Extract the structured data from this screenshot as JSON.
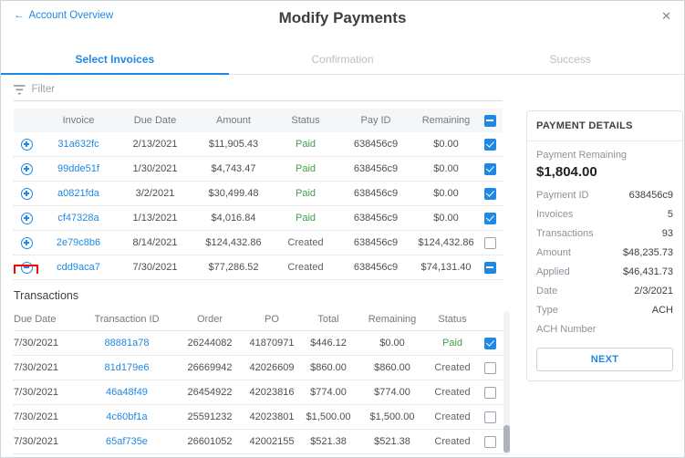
{
  "header": {
    "back_arrow": "←",
    "back_label": "Account Overview",
    "title": "Modify Payments",
    "close_glyph": "✕"
  },
  "tabs": [
    {
      "label": "Select Invoices",
      "active": true
    },
    {
      "label": "Confirmation",
      "active": false
    },
    {
      "label": "Success",
      "active": false
    }
  ],
  "filter": {
    "placeholder": "Filter"
  },
  "invoice_table": {
    "columns": [
      "Invoice",
      "Due Date",
      "Amount",
      "Status",
      "Pay ID",
      "Remaining"
    ],
    "header_checkbox": "indeterminate",
    "rows": [
      {
        "expand": "plus",
        "invoice": "31a632fc",
        "due_date": "2/13/2021",
        "amount": "$11,905.43",
        "status": "Paid",
        "pay_id": "638456c9",
        "remaining": "$0.00",
        "checkbox": "checked"
      },
      {
        "expand": "plus",
        "invoice": "99dde51f",
        "due_date": "1/30/2021",
        "amount": "$4,743.47",
        "status": "Paid",
        "pay_id": "638456c9",
        "remaining": "$0.00",
        "checkbox": "checked"
      },
      {
        "expand": "plus",
        "invoice": "a0821fda",
        "due_date": "3/2/2021",
        "amount": "$30,499.48",
        "status": "Paid",
        "pay_id": "638456c9",
        "remaining": "$0.00",
        "checkbox": "checked"
      },
      {
        "expand": "plus",
        "invoice": "cf47328a",
        "due_date": "1/13/2021",
        "amount": "$4,016.84",
        "status": "Paid",
        "pay_id": "638456c9",
        "remaining": "$0.00",
        "checkbox": "checked"
      },
      {
        "expand": "plus",
        "invoice": "2e79c8b6",
        "due_date": "8/14/2021",
        "amount": "$124,432.86",
        "status": "Created",
        "pay_id": "638456c9",
        "remaining": "$124,432.86",
        "checkbox": "unchecked"
      },
      {
        "expand": "minus",
        "invoice": "cdd9aca7",
        "due_date": "7/30/2021",
        "amount": "$77,286.52",
        "status": "Created",
        "pay_id": "638456c9",
        "remaining": "$74,131.40",
        "checkbox": "indeterminate"
      }
    ]
  },
  "transactions": {
    "title": "Transactions",
    "columns": [
      "Due Date",
      "Transaction ID",
      "Order",
      "PO",
      "Total",
      "Remaining",
      "Status"
    ],
    "rows": [
      {
        "due_date": "7/30/2021",
        "transaction_id": "88881a78",
        "order": "26244082",
        "po": "41870971",
        "total": "$446.12",
        "remaining": "$0.00",
        "status": "Paid",
        "checkbox": "checked"
      },
      {
        "due_date": "7/30/2021",
        "transaction_id": "81d179e6",
        "order": "26669942",
        "po": "42026609",
        "total": "$860.00",
        "remaining": "$860.00",
        "status": "Created",
        "checkbox": "unchecked"
      },
      {
        "due_date": "7/30/2021",
        "transaction_id": "46a48f49",
        "order": "26454922",
        "po": "42023816",
        "total": "$774.00",
        "remaining": "$774.00",
        "status": "Created",
        "checkbox": "unchecked"
      },
      {
        "due_date": "7/30/2021",
        "transaction_id": "4c60bf1a",
        "order": "25591232",
        "po": "42023801",
        "total": "$1,500.00",
        "remaining": "$1,500.00",
        "status": "Created",
        "checkbox": "unchecked"
      },
      {
        "due_date": "7/30/2021",
        "transaction_id": "65af735e",
        "order": "26601052",
        "po": "42002155",
        "total": "$521.38",
        "remaining": "$521.38",
        "status": "Created",
        "checkbox": "unchecked"
      }
    ]
  },
  "payment_details": {
    "title": "PAYMENT DETAILS",
    "remaining_label": "Payment Remaining",
    "remaining_value": "$1,804.00",
    "fields": [
      {
        "label": "Payment ID",
        "value": "638456c9"
      },
      {
        "label": "Invoices",
        "value": "5"
      },
      {
        "label": "Transactions",
        "value": "93"
      },
      {
        "label": "Amount",
        "value": "$48,235.73"
      },
      {
        "label": "Applied",
        "value": "$46,431.73"
      },
      {
        "label": "Date",
        "value": "2/3/2021"
      },
      {
        "label": "Type",
        "value": "ACH"
      },
      {
        "label": "ACH Number",
        "value": ""
      }
    ],
    "next_label": "NEXT"
  },
  "colors": {
    "accent": "#1e88e5",
    "paid_green": "#43a047",
    "annotation_red": "#ff0000",
    "header_bg": "#f5f6f7"
  }
}
